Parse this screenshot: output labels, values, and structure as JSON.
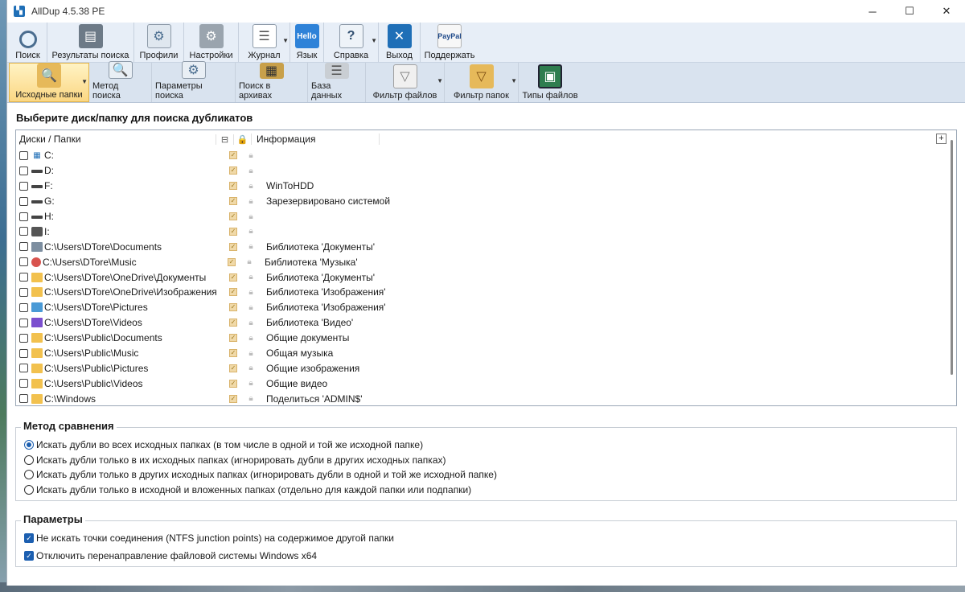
{
  "window": {
    "title": "AllDup 4.5.38 PE",
    "controls": [
      "─",
      "☐",
      "✕"
    ]
  },
  "toolbar_main": [
    {
      "label": "Поиск",
      "icon": "search-icon"
    },
    {
      "label": "Результаты поиска",
      "icon": "results-icon"
    },
    {
      "label": "Профили",
      "icon": "profiles-icon"
    },
    {
      "label": "Настройки",
      "icon": "settings-icon"
    },
    {
      "label": "Журнал",
      "icon": "journal-icon"
    },
    {
      "label": "Язык",
      "icon": "language-icon",
      "icon_text": "Hello"
    },
    {
      "label": "Справка",
      "icon": "help-icon"
    },
    {
      "label": "Выход",
      "icon": "exit-icon"
    },
    {
      "label": "Поддержать",
      "icon": "paypal-icon",
      "icon_text": "PayPal"
    }
  ],
  "toolbar_sub": [
    {
      "label": "Исходные папки",
      "icon": "source-folders-icon",
      "active": true
    },
    {
      "label": "Метод поиска",
      "icon": "search-method-icon"
    },
    {
      "label": "Параметры поиска",
      "icon": "search-params-icon"
    },
    {
      "label": "Поиск в архивах",
      "icon": "archive-search-icon"
    },
    {
      "label": "База данных",
      "icon": "database-icon"
    },
    {
      "label": "Фильтр файлов",
      "icon": "file-filter-icon"
    },
    {
      "label": "Фильтр папок",
      "icon": "folder-filter-icon"
    },
    {
      "label": "Типы файлов",
      "icon": "file-types-icon"
    }
  ],
  "source_section": {
    "title": "Выберите диск/папку для поиска дубликатов",
    "columns": {
      "name": "Диски / Папки",
      "info": "Информация"
    },
    "rows": [
      {
        "name": "C:",
        "info": "",
        "icon": "windows-drive-icon"
      },
      {
        "name": "D:",
        "info": "",
        "icon": "drive-icon"
      },
      {
        "name": "F:",
        "info": "WinToHDD",
        "icon": "drive-icon"
      },
      {
        "name": "G:",
        "info": "Зарезервировано системой",
        "icon": "drive-icon"
      },
      {
        "name": "H:",
        "info": "",
        "icon": "drive-icon"
      },
      {
        "name": "I:",
        "info": "",
        "icon": "network-drive-icon"
      },
      {
        "name": "C:\\Users\\DTore\\Documents",
        "info": "Библиотека 'Документы'",
        "icon": "documents-icon"
      },
      {
        "name": "C:\\Users\\DTore\\Music",
        "info": "Библиотека 'Музыка'",
        "icon": "music-icon"
      },
      {
        "name": "C:\\Users\\DTore\\OneDrive\\Документы",
        "info": "Библиотека 'Документы'",
        "icon": "folder-icon"
      },
      {
        "name": "C:\\Users\\DTore\\OneDrive\\Изображения",
        "info": "Библиотека 'Изображения'",
        "icon": "folder-icon"
      },
      {
        "name": "C:\\Users\\DTore\\Pictures",
        "info": "Библиотека 'Изображения'",
        "icon": "pictures-icon"
      },
      {
        "name": "C:\\Users\\DTore\\Videos",
        "info": "Библиотека 'Видео'",
        "icon": "videos-icon"
      },
      {
        "name": "C:\\Users\\Public\\Documents",
        "info": "Общие документы",
        "icon": "folder-icon"
      },
      {
        "name": "C:\\Users\\Public\\Music",
        "info": "Общая музыка",
        "icon": "folder-icon"
      },
      {
        "name": "C:\\Users\\Public\\Pictures",
        "info": "Общие изображения",
        "icon": "folder-icon"
      },
      {
        "name": "C:\\Users\\Public\\Videos",
        "info": "Общие видео",
        "icon": "folder-icon"
      },
      {
        "name": "C:\\Windows",
        "info": "Поделиться 'ADMIN$'",
        "icon": "folder-icon"
      }
    ]
  },
  "compare_method": {
    "title": "Метод сравнения",
    "options": [
      {
        "label": "Искать дубли во всех исходных папках (в том числе в одной и той же исходной папке)",
        "selected": true
      },
      {
        "label": "Искать дубли только в их исходных папках (игнорировать дубли в других исходных папках)",
        "selected": false
      },
      {
        "label": "Искать дубли только в других исходных папках (игнорировать дубли в одной и той же исходной папке)",
        "selected": false
      },
      {
        "label": "Искать дубли только в исходной и вложенных папках (отдельно для каждой папки или подпапки)",
        "selected": false
      }
    ]
  },
  "parameters": {
    "title": "Параметры",
    "options": [
      {
        "label": "Не искать точки соединения (NTFS junction points) на содержимое другой папки",
        "checked": true
      },
      {
        "label": "Отключить перенаправление файловой системы Windows x64",
        "checked": true
      }
    ]
  },
  "colors": {
    "accent": "#1c5fb0",
    "toolbar_bg": "#e7eef7",
    "active_tab": "#fbd783"
  }
}
